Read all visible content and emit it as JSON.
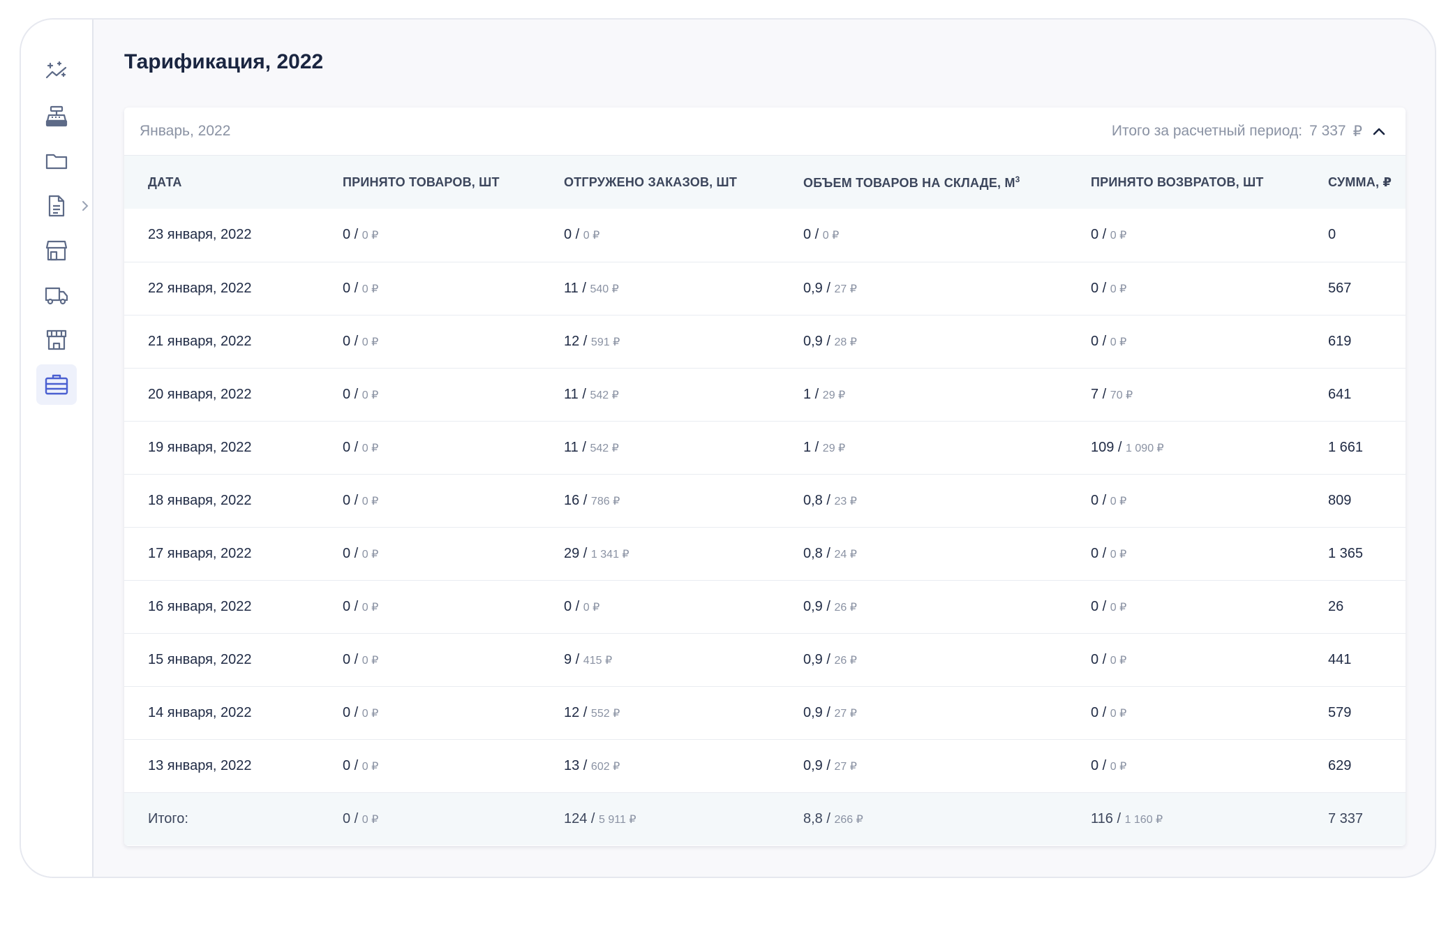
{
  "page": {
    "title": "Тарификация, 2022"
  },
  "sidebar": {
    "items": [
      {
        "name": "analytics-icon"
      },
      {
        "name": "cash-register-icon"
      },
      {
        "name": "folder-icon"
      },
      {
        "name": "document-icon"
      },
      {
        "name": "store-icon"
      },
      {
        "name": "delivery-truck-icon"
      },
      {
        "name": "warehouse-icon"
      },
      {
        "name": "briefcase-icon",
        "active": true
      }
    ],
    "accent": "#4a5fd1"
  },
  "card": {
    "period_label": "Январь, 2022",
    "total_label": "Итого за расчетный период:",
    "total_value": "7 337",
    "total_currency": "₽"
  },
  "table": {
    "headers": {
      "date": "Дата",
      "received": "Принято товаров, шт",
      "shipped": "Отгружено заказов, шт",
      "volume": "Объем товаров на складе, м",
      "volume_sup": "3",
      "returns": "Принято возвратов, шт",
      "sum": "Сумма, ₽"
    },
    "rows": [
      {
        "date": "23 января, 2022",
        "received": "0 / ",
        "received_money": "0 ₽",
        "shipped": "0 / ",
        "shipped_money": "0 ₽",
        "volume": "0 / ",
        "volume_money": "0 ₽",
        "returns": "0 / ",
        "returns_money": "0 ₽",
        "sum": "0"
      },
      {
        "date": "22 января, 2022",
        "received": "0 / ",
        "received_money": "0 ₽",
        "shipped": "11 / ",
        "shipped_money": "540 ₽",
        "volume": "0,9 / ",
        "volume_money": "27 ₽",
        "returns": "0 / ",
        "returns_money": "0 ₽",
        "sum": "567"
      },
      {
        "date": "21 января, 2022",
        "received": "0 / ",
        "received_money": "0 ₽",
        "shipped": "12 / ",
        "shipped_money": "591 ₽",
        "volume": "0,9 / ",
        "volume_money": "28 ₽",
        "returns": "0 / ",
        "returns_money": "0 ₽",
        "sum": "619"
      },
      {
        "date": "20 января, 2022",
        "received": "0 / ",
        "received_money": "0 ₽",
        "shipped": "11 / ",
        "shipped_money": "542 ₽",
        "volume": "1 / ",
        "volume_money": "29 ₽",
        "returns": "7 / ",
        "returns_money": "70 ₽",
        "sum": "641"
      },
      {
        "date": "19 января, 2022",
        "received": "0 / ",
        "received_money": "0 ₽",
        "shipped": "11 / ",
        "shipped_money": "542 ₽",
        "volume": "1 / ",
        "volume_money": "29 ₽",
        "returns": "109 / ",
        "returns_money": "1 090 ₽",
        "sum": "1 661"
      },
      {
        "date": "18 января, 2022",
        "received": "0 / ",
        "received_money": "0 ₽",
        "shipped": "16 / ",
        "shipped_money": "786 ₽",
        "volume": "0,8 / ",
        "volume_money": "23 ₽",
        "returns": "0 / ",
        "returns_money": "0 ₽",
        "sum": "809"
      },
      {
        "date": "17 января, 2022",
        "received": "0 / ",
        "received_money": "0 ₽",
        "shipped": "29 / ",
        "shipped_money": "1 341 ₽",
        "volume": "0,8 / ",
        "volume_money": "24 ₽",
        "returns": "0 / ",
        "returns_money": "0 ₽",
        "sum": "1 365"
      },
      {
        "date": "16 января, 2022",
        "received": "0 / ",
        "received_money": "0 ₽",
        "shipped": "0 / ",
        "shipped_money": "0 ₽",
        "volume": "0,9 / ",
        "volume_money": "26 ₽",
        "returns": "0 / ",
        "returns_money": "0 ₽",
        "sum": "26"
      },
      {
        "date": "15 января, 2022",
        "received": "0 / ",
        "received_money": "0 ₽",
        "shipped": "9 / ",
        "shipped_money": "415 ₽",
        "volume": "0,9 / ",
        "volume_money": "26 ₽",
        "returns": "0 / ",
        "returns_money": "0 ₽",
        "sum": "441"
      },
      {
        "date": "14 января, 2022",
        "received": "0 / ",
        "received_money": "0 ₽",
        "shipped": "12 / ",
        "shipped_money": "552 ₽",
        "volume": "0,9 / ",
        "volume_money": "27 ₽",
        "returns": "0 / ",
        "returns_money": "0 ₽",
        "sum": "579"
      },
      {
        "date": "13 января, 2022",
        "received": "0 / ",
        "received_money": "0 ₽",
        "shipped": "13 / ",
        "shipped_money": "602 ₽",
        "volume": "0,9 / ",
        "volume_money": "27 ₽",
        "returns": "0 / ",
        "returns_money": "0 ₽",
        "sum": "629"
      }
    ],
    "totals": {
      "label": "Итого:",
      "received": "0 / ",
      "received_money": "0 ₽",
      "shipped": "124 / ",
      "shipped_money": "5 911 ₽",
      "volume": "8,8 / ",
      "volume_money": "266 ₽",
      "returns": "116 / ",
      "returns_money": "1 160 ₽",
      "sum": "7 337"
    }
  }
}
